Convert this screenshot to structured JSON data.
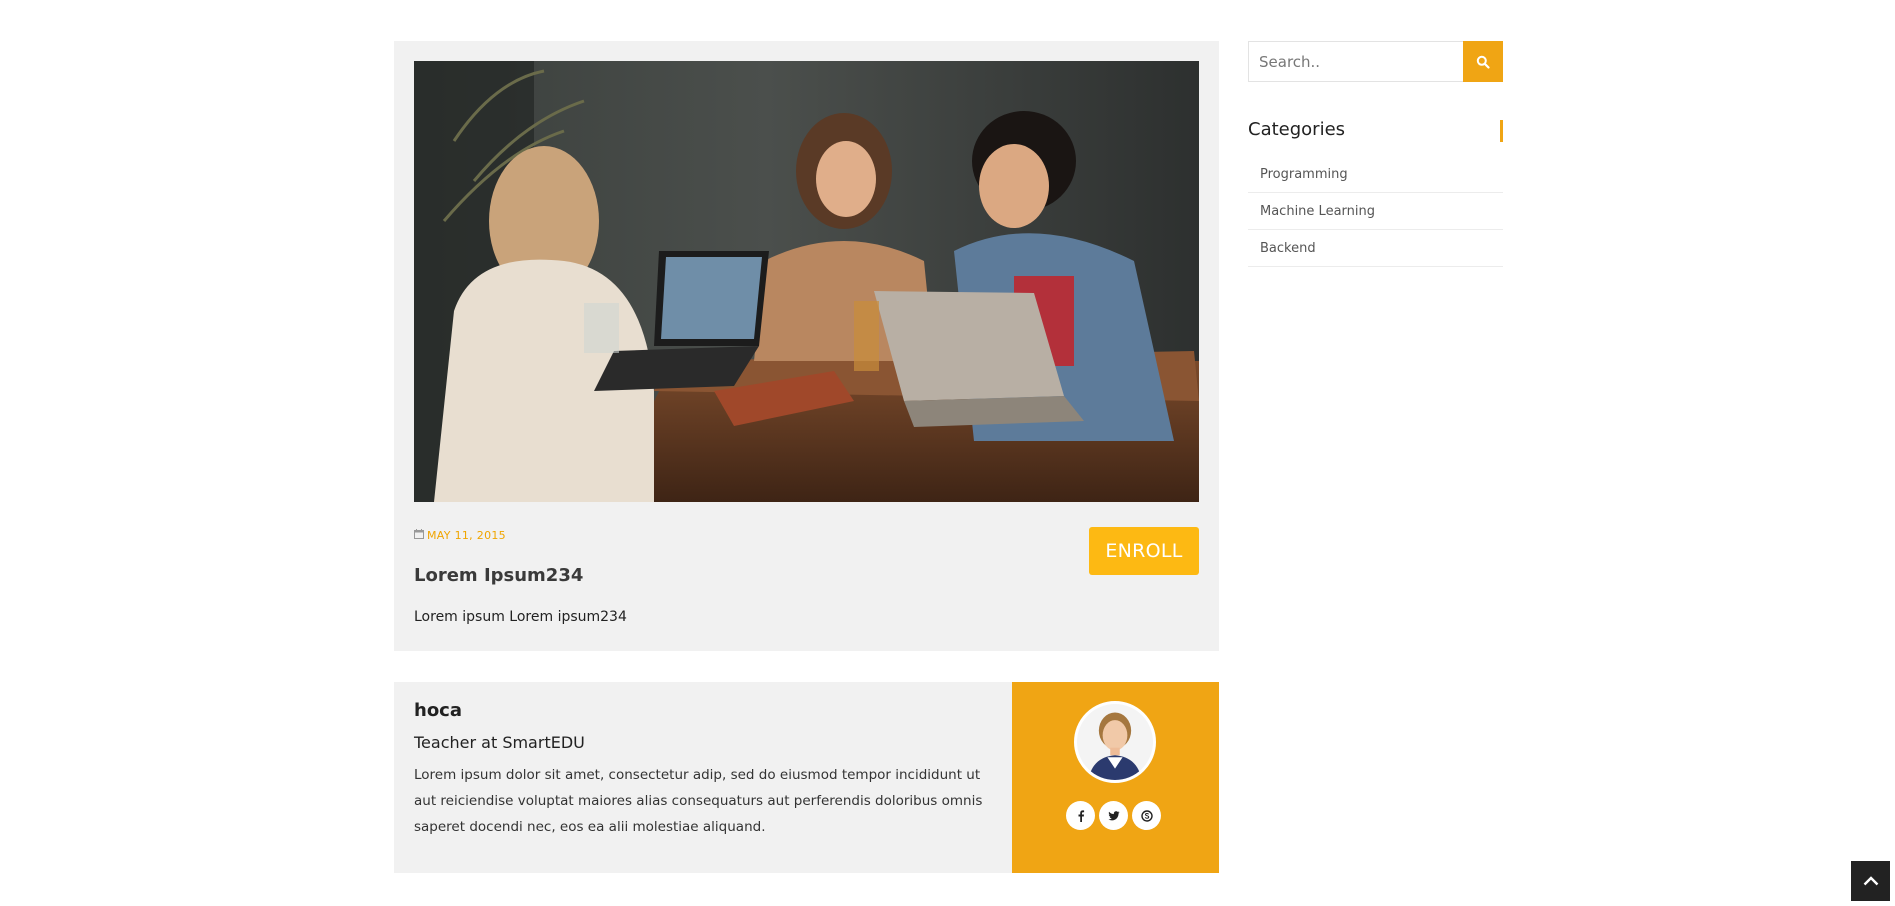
{
  "course": {
    "date": "MAY 11, 2015",
    "title": "Lorem Ipsum234",
    "description": "Lorem ipsum Lorem ipsum234",
    "enroll_label": "ENROLL",
    "image_icon": "course-photo"
  },
  "teacher": {
    "name": "hoca",
    "role": "Teacher at SmartEDU",
    "bio": "Lorem ipsum dolor sit amet, consectetur adip, sed do eiusmod tempor incididunt ut aut reiciendise voluptat maiores alias consequaturs aut perferendis doloribus omnis saperet docendi nec, eos ea alii molestiae aliquand.",
    "social_icons": [
      "facebook-icon",
      "twitter-icon",
      "skype-icon"
    ]
  },
  "sidebar": {
    "search": {
      "placeholder": "Search..",
      "value": ""
    },
    "categories_title": "Categories",
    "categories": [
      {
        "label": "Programming"
      },
      {
        "label": "Machine Learning"
      },
      {
        "label": "Backend"
      }
    ]
  },
  "colors": {
    "accent": "#f0a514",
    "enroll": "#fdb913",
    "card_bg": "#f1f1f1",
    "scroll_top_bg": "#222222"
  }
}
